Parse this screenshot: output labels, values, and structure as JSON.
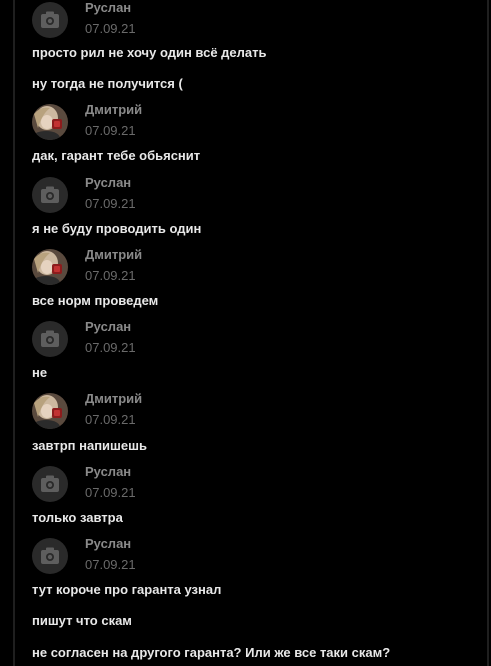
{
  "users": {
    "ruslan": "Руслан",
    "dmitry": "Дмитрий"
  },
  "date": "07.09.21",
  "messages": [
    "просто рил не хочу один всё делать",
    "ну тогда не получится (",
    "дак, гарант тебе обьяснит",
    "я не буду проводить один",
    "все норм проведем",
    "не",
    "завтрп напишешь",
    "только завтра",
    "тут короче про гаранта узнал",
    "пишут что скам",
    "не согласен на другого гаранта? Или же все таки скам?"
  ],
  "icons": {
    "default_avatar": "camera-icon",
    "dmitry_avatar": "profile-photo"
  },
  "colors": {
    "background": "#000000",
    "message_text": "#e8e8e8",
    "author_name": "#8a8a8a",
    "timestamp": "#6a6a6a",
    "avatar_placeholder": "#2a2a2a"
  }
}
